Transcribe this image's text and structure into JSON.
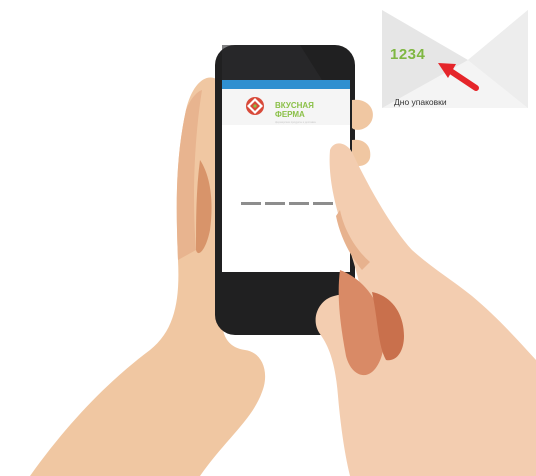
{
  "callout": {
    "code": "1234",
    "label": "Дно упаковки"
  },
  "phone": {
    "app_title_line1": "Вкусная",
    "app_title_line2": "Ферма",
    "app_subtitle": "фермерские продукты и доставка",
    "code_slots": [
      "",
      "",
      "",
      ""
    ]
  },
  "colors": {
    "brand_green": "#8bc048",
    "code_green": "#7fb742",
    "arrow_red": "#e5252a",
    "logo_red": "#d84a3a",
    "screen_top_bar": "#2f8fd0"
  }
}
